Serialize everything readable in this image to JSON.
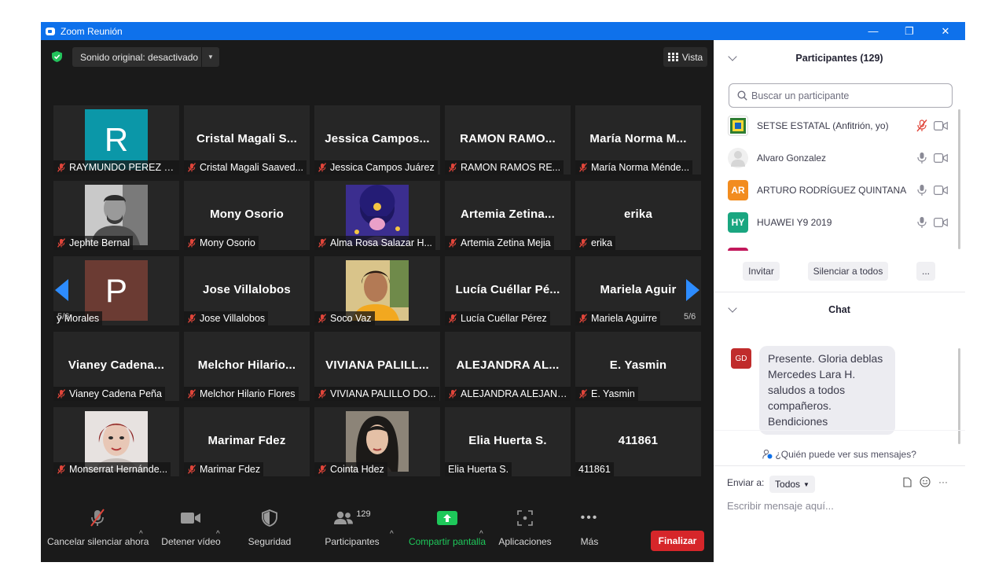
{
  "window": {
    "title": "Zoom Reunión",
    "minimize": "—",
    "restore": "❐",
    "close": "✕"
  },
  "top": {
    "audio": "Sonido original: desactivado",
    "view": "Vista"
  },
  "pages": {
    "left": "5/6",
    "right": "5/6"
  },
  "tiles": [
    {
      "big": "",
      "name": "RAYMUNDO PEREZ Z...",
      "muted": true,
      "avatar": "R",
      "avatar_color": "#0b97a8"
    },
    {
      "big": "Cristal Magali S...",
      "name": "Cristal Magali Saaved...",
      "muted": true
    },
    {
      "big": "Jessica Campos...",
      "name": "Jessica Campos Juárez",
      "muted": true
    },
    {
      "big": "RAMON RAMO...",
      "name": "RAMON RAMOS RE...",
      "muted": true
    },
    {
      "big": "María Norma M...",
      "name": "María Norma Ménde...",
      "muted": true
    },
    {
      "big": "",
      "name": "Jephte Bernal",
      "muted": true,
      "photo": "man"
    },
    {
      "big": "Mony Osorio",
      "name": "Mony Osorio",
      "muted": true
    },
    {
      "big": "",
      "name": "Alma Rosa Salazar H...",
      "muted": true,
      "photo": "illustration"
    },
    {
      "big": "Artemia Zetina...",
      "name": "Artemia Zetina Mejia",
      "muted": true
    },
    {
      "big": "erika",
      "name": "erika",
      "muted": true
    },
    {
      "big": "",
      "name": "y Morales",
      "muted": false,
      "avatar": "P",
      "avatar_color": "#6b3b33"
    },
    {
      "big": "Jose Villalobos",
      "name": "Jose Villalobos",
      "muted": true
    },
    {
      "big": "",
      "name": "Soco Vaz",
      "muted": true,
      "photo": "woman-yellow"
    },
    {
      "big": "Lucía Cuéllar Pé...",
      "name": "Lucía Cuéllar Pérez",
      "muted": true
    },
    {
      "big": "Mariela Aguir",
      "name": "Mariela Aguirre",
      "muted": true
    },
    {
      "big": "Vianey Cadena...",
      "name": "Vianey Cadena Peña",
      "muted": true
    },
    {
      "big": "Melchor Hilario...",
      "name": "Melchor Hilario Flores",
      "muted": true
    },
    {
      "big": "VIVIANA PALILL...",
      "name": "VIVIANA PALILLO DO...",
      "muted": true
    },
    {
      "big": "ALEJANDRA AL...",
      "name": "ALEJANDRA ALEJAND...",
      "muted": true
    },
    {
      "big": "E. Yasmin",
      "name": "E. Yasmin",
      "muted": true
    },
    {
      "big": "",
      "name": "Monserrat Hernánde...",
      "muted": true,
      "photo": "woman-red"
    },
    {
      "big": "Marimar Fdez",
      "name": "Marimar Fdez",
      "muted": true
    },
    {
      "big": "",
      "name": "Cointa Hdez",
      "muted": true,
      "photo": "woman-dark"
    },
    {
      "big": "Elia Huerta S.",
      "name": "Elia Huerta S.",
      "muted": false
    },
    {
      "big": "411861",
      "name": "411861",
      "muted": false
    }
  ],
  "toolbar": {
    "unmute": "Cancelar silenciar ahora",
    "video": "Detener vídeo",
    "security": "Seguridad",
    "participants": "Participantes",
    "participants_count": "129",
    "share": "Compartir pantalla",
    "apps": "Aplicaciones",
    "more": "Más",
    "end": "Finalizar"
  },
  "participants_panel": {
    "title": "Participantes (129)",
    "search_placeholder": "Buscar un participante",
    "list": [
      {
        "name": "SETSE ESTATAL (Anfitrión, yo)",
        "avatar": "",
        "color": "#ffffff",
        "muted": true
      },
      {
        "name": "Alvaro Gonzalez",
        "avatar": "",
        "color": "#e6e6e6",
        "muted": false
      },
      {
        "name": "ARTURO RODRÍGUEZ QUINTANA",
        "avatar": "AR",
        "color": "#f28c1f",
        "muted": false
      },
      {
        "name": "HUAWEI Y9 2019",
        "avatar": "HY",
        "color": "#1aa680",
        "muted": false
      }
    ],
    "invite": "Invitar",
    "mute_all": "Silenciar a todos",
    "more": "..."
  },
  "chat": {
    "title": "Chat",
    "sender_initials": "GD",
    "message": "Presente. Gloria deblas Mercedes Lara H. saludos a todos compañeros. Bendiciones",
    "who_can_see": "¿Quién puede ver sus mensajes?",
    "send_to_label": "Enviar a:",
    "send_to_value": "Todos",
    "placeholder": "Escribir mensaje aquí..."
  },
  "colors": {
    "titlebar": "#0e71eb",
    "accent": "#2d8cff",
    "end": "#d6262a",
    "share": "#1ec85a",
    "muted": "#e0453a"
  }
}
